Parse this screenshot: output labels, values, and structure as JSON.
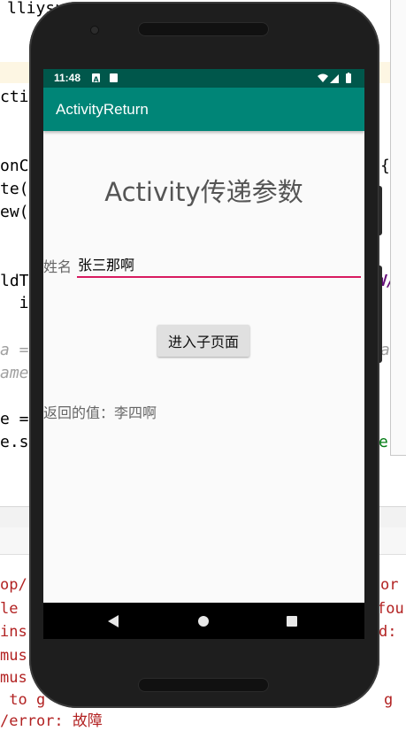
{
  "ide": {
    "code_lines": [
      "lliysu",
      "ctiv",
      "onC",
      "te(",
      "ew(",
      "ldT",
      "  in",
      "a =",
      "ame",
      "e =",
      "e.s"
    ],
    "right_fragments": [
      "{",
      "a",
      "W/",
      "e'"
    ],
    "console_lines": [
      "op/",
      "le",
      "ins",
      "mus",
      "mus",
      " to g",
      "/error: 故障"
    ],
    "console_right": [
      "or",
      "fou",
      "d:",
      "g"
    ]
  },
  "status_bar": {
    "time": "11:48"
  },
  "app_bar": {
    "title": "ActivityReturn"
  },
  "main": {
    "heading": "Activity传递参数",
    "name_label": "姓名",
    "name_value": "张三那啊",
    "enter_button": "进入子页面",
    "return_label": "返回的值：李四啊"
  },
  "nav_bar": {
    "icons": [
      "back-icon",
      "home-icon",
      "recents-icon"
    ]
  },
  "colors": {
    "status_bar": "#00574b",
    "app_bar": "#008577",
    "accent": "#d81b60"
  }
}
